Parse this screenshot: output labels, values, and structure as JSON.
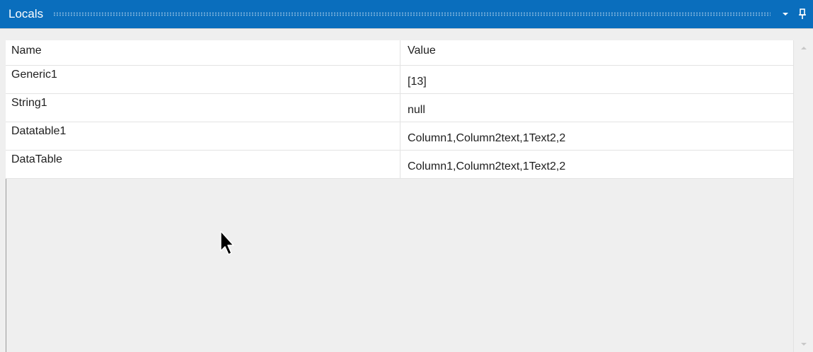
{
  "window": {
    "title": "Locals"
  },
  "grid": {
    "columns": [
      "Name",
      "Value"
    ],
    "rows": [
      {
        "name": "Generic1",
        "value": "[13]"
      },
      {
        "name": "String1",
        "value": "null"
      },
      {
        "name": "Datatable1",
        "value": "Column1,Column2text,1Text2,2"
      },
      {
        "name": "DataTable",
        "value": "Column1,Column2text,1Text2,2"
      }
    ]
  },
  "icons": {
    "dropdown": "chevron-down-icon",
    "pin": "pin-icon",
    "scroll_up": "scroll-up-arrow-icon",
    "scroll_down": "scroll-down-arrow-icon",
    "cursor": "mouse-pointer-icon"
  },
  "colors": {
    "titlebar": "#0a6ebd",
    "title_text": "#ffffff",
    "grid_background": "#ffffff",
    "panel_background": "#efefef"
  }
}
